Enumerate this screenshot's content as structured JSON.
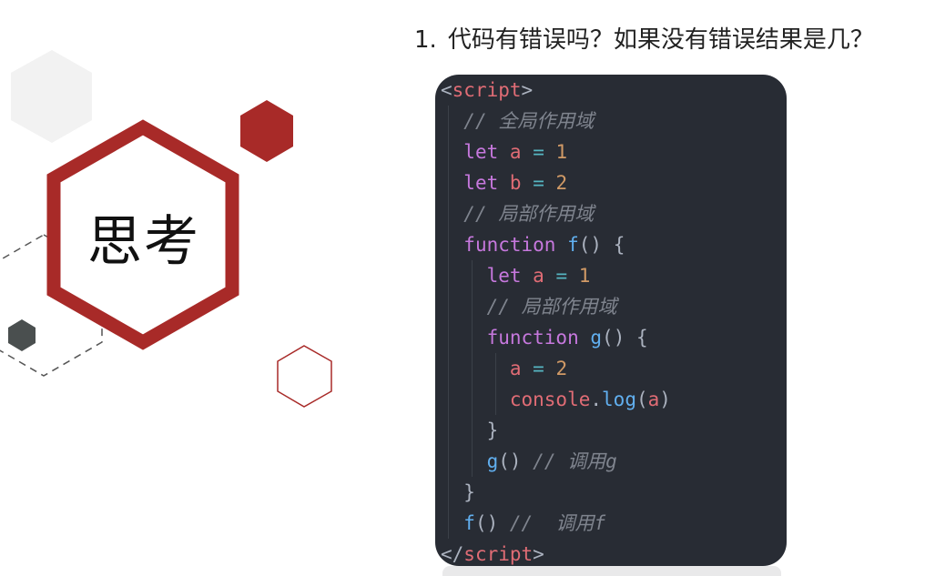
{
  "slide": {
    "title_label": "思考",
    "question": {
      "number": "1.",
      "text": "代码有错误吗？如果没有错误结果是几？"
    }
  },
  "colors": {
    "accent_red": "#a82a28",
    "code_bg": "#282c34",
    "light_hex": "#f2f2f2",
    "dark_hex": "#4a4f4f"
  },
  "icons": {
    "big_hexagon": "hexagon-outline-red",
    "small_hexagons": [
      "hexagon-gray",
      "hexagon-red-filled",
      "hexagon-outline-red",
      "hexagon-dark",
      "hexagon-dashed"
    ]
  },
  "code": {
    "language": "javascript",
    "lines": [
      [
        {
          "t": "<",
          "c": "punc"
        },
        {
          "t": "script",
          "c": "tag"
        },
        {
          "t": ">",
          "c": "punc"
        }
      ],
      [
        {
          "t": "  ",
          "c": "punc"
        },
        {
          "t": "// 全局作用域",
          "c": "cmt"
        }
      ],
      [
        {
          "t": "  ",
          "c": "punc"
        },
        {
          "t": "let",
          "c": "kw"
        },
        {
          "t": " ",
          "c": "punc"
        },
        {
          "t": "a",
          "c": "var"
        },
        {
          "t": " ",
          "c": "punc"
        },
        {
          "t": "=",
          "c": "op"
        },
        {
          "t": " ",
          "c": "punc"
        },
        {
          "t": "1",
          "c": "num-lit"
        }
      ],
      [
        {
          "t": "  ",
          "c": "punc"
        },
        {
          "t": "let",
          "c": "kw"
        },
        {
          "t": " ",
          "c": "punc"
        },
        {
          "t": "b",
          "c": "var"
        },
        {
          "t": " ",
          "c": "punc"
        },
        {
          "t": "=",
          "c": "op"
        },
        {
          "t": " ",
          "c": "punc"
        },
        {
          "t": "2",
          "c": "num-lit"
        }
      ],
      [
        {
          "t": "  ",
          "c": "punc"
        },
        {
          "t": "// 局部作用域",
          "c": "cmt"
        }
      ],
      [
        {
          "t": "  ",
          "c": "punc"
        },
        {
          "t": "function",
          "c": "kw"
        },
        {
          "t": " ",
          "c": "punc"
        },
        {
          "t": "f",
          "c": "fn"
        },
        {
          "t": "() {",
          "c": "punc"
        }
      ],
      [
        {
          "t": "    ",
          "c": "punc"
        },
        {
          "t": "let",
          "c": "kw"
        },
        {
          "t": " ",
          "c": "punc"
        },
        {
          "t": "a",
          "c": "var"
        },
        {
          "t": " ",
          "c": "punc"
        },
        {
          "t": "=",
          "c": "op"
        },
        {
          "t": " ",
          "c": "punc"
        },
        {
          "t": "1",
          "c": "num-lit"
        }
      ],
      [
        {
          "t": "    ",
          "c": "punc"
        },
        {
          "t": "// 局部作用域",
          "c": "cmt"
        }
      ],
      [
        {
          "t": "    ",
          "c": "punc"
        },
        {
          "t": "function",
          "c": "kw"
        },
        {
          "t": " ",
          "c": "punc"
        },
        {
          "t": "g",
          "c": "fn"
        },
        {
          "t": "() {",
          "c": "punc"
        }
      ],
      [
        {
          "t": "      ",
          "c": "punc"
        },
        {
          "t": "a",
          "c": "var"
        },
        {
          "t": " ",
          "c": "punc"
        },
        {
          "t": "=",
          "c": "op"
        },
        {
          "t": " ",
          "c": "punc"
        },
        {
          "t": "2",
          "c": "num-lit"
        }
      ],
      [
        {
          "t": "      ",
          "c": "punc"
        },
        {
          "t": "console",
          "c": "var"
        },
        {
          "t": ".",
          "c": "punc"
        },
        {
          "t": "log",
          "c": "fn"
        },
        {
          "t": "(",
          "c": "punc"
        },
        {
          "t": "a",
          "c": "var"
        },
        {
          "t": ")",
          "c": "punc"
        }
      ],
      [
        {
          "t": "    }",
          "c": "punc"
        }
      ],
      [
        {
          "t": "    ",
          "c": "punc"
        },
        {
          "t": "g",
          "c": "fn"
        },
        {
          "t": "() ",
          "c": "punc"
        },
        {
          "t": "// 调用g",
          "c": "cmt"
        }
      ],
      [
        {
          "t": "  }",
          "c": "punc"
        }
      ],
      [
        {
          "t": "  ",
          "c": "punc"
        },
        {
          "t": "f",
          "c": "fn"
        },
        {
          "t": "() ",
          "c": "punc"
        },
        {
          "t": "//  调用f",
          "c": "cmt"
        }
      ],
      [
        {
          "t": "</",
          "c": "punc"
        },
        {
          "t": "script",
          "c": "tag"
        },
        {
          "t": ">",
          "c": "punc"
        }
      ]
    ]
  }
}
